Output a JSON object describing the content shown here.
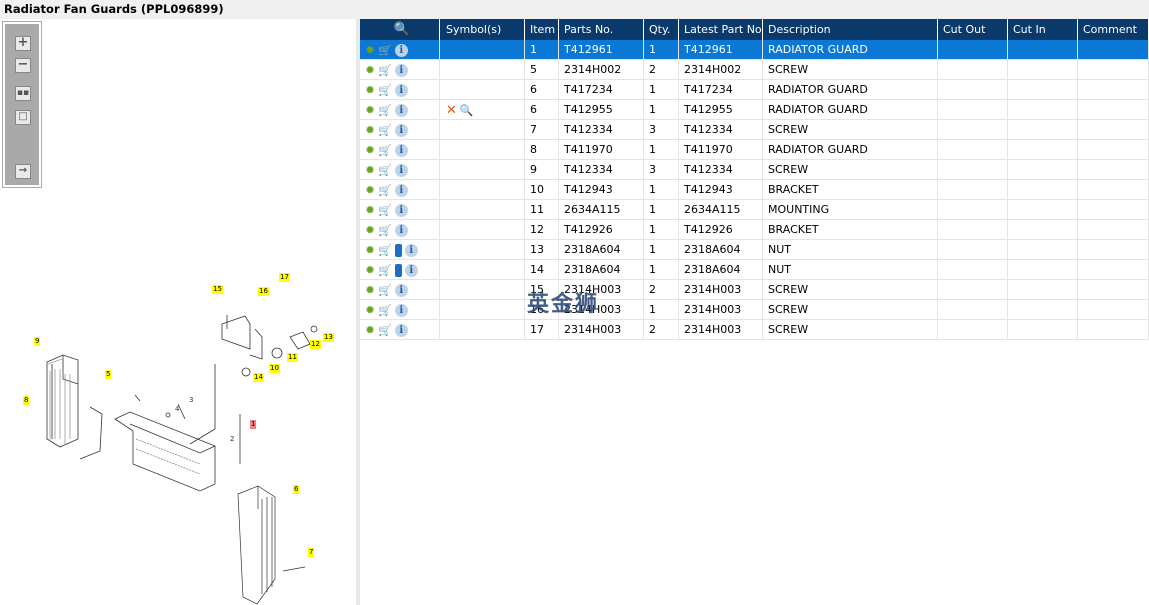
{
  "title": "Radiator Fan Guards (PPL096899)",
  "toolbar": [
    "zoom-in",
    "zoom-out",
    "fit-all",
    "fit-window",
    "export"
  ],
  "callouts": [
    "15",
    "16",
    "17",
    "13",
    "12",
    "11",
    "10",
    "14",
    "9",
    "8",
    "5",
    "1",
    "6",
    "7"
  ],
  "plain_labels": [
    "3",
    "4",
    "2"
  ],
  "columns": [
    "",
    "Symbol(s)",
    "Item",
    "Parts No.",
    "Qty.",
    "Latest Part No.",
    "Description",
    "Cut Out",
    "Cut In",
    "Comment"
  ],
  "rows": [
    {
      "item": "1",
      "part": "T412961",
      "qty": "1",
      "latest": "T412961",
      "desc": "RADIATOR GUARD",
      "selected": true
    },
    {
      "item": "5",
      "part": "2314H002",
      "qty": "2",
      "latest": "2314H002",
      "desc": "SCREW"
    },
    {
      "item": "6",
      "part": "T417234",
      "qty": "1",
      "latest": "T417234",
      "desc": "RADIATOR GUARD"
    },
    {
      "item": "6",
      "part": "T412955",
      "qty": "1",
      "latest": "T412955",
      "desc": "RADIATOR GUARD",
      "symbols": true
    },
    {
      "item": "7",
      "part": "T412334",
      "qty": "3",
      "latest": "T412334",
      "desc": "SCREW"
    },
    {
      "item": "8",
      "part": "T411970",
      "qty": "1",
      "latest": "T411970",
      "desc": "RADIATOR GUARD"
    },
    {
      "item": "9",
      "part": "T412334",
      "qty": "3",
      "latest": "T412334",
      "desc": "SCREW"
    },
    {
      "item": "10",
      "part": "T412943",
      "qty": "1",
      "latest": "T412943",
      "desc": "BRACKET"
    },
    {
      "item": "11",
      "part": "2634A115",
      "qty": "1",
      "latest": "2634A115",
      "desc": "MOUNTING"
    },
    {
      "item": "12",
      "part": "T412926",
      "qty": "1",
      "latest": "T412926",
      "desc": "BRACKET"
    },
    {
      "item": "13",
      "part": "2318A604",
      "qty": "1",
      "latest": "2318A604",
      "desc": "NUT",
      "book": true
    },
    {
      "item": "14",
      "part": "2318A604",
      "qty": "1",
      "latest": "2318A604",
      "desc": "NUT",
      "book": true
    },
    {
      "item": "15",
      "part": "2314H003",
      "qty": "2",
      "latest": "2314H003",
      "desc": "SCREW"
    },
    {
      "item": "16",
      "part": "2314H003",
      "qty": "1",
      "latest": "2314H003",
      "desc": "SCREW"
    },
    {
      "item": "17",
      "part": "2314H003",
      "qty": "2",
      "latest": "2314H003",
      "desc": "SCREW"
    }
  ],
  "watermark": "英金狮"
}
